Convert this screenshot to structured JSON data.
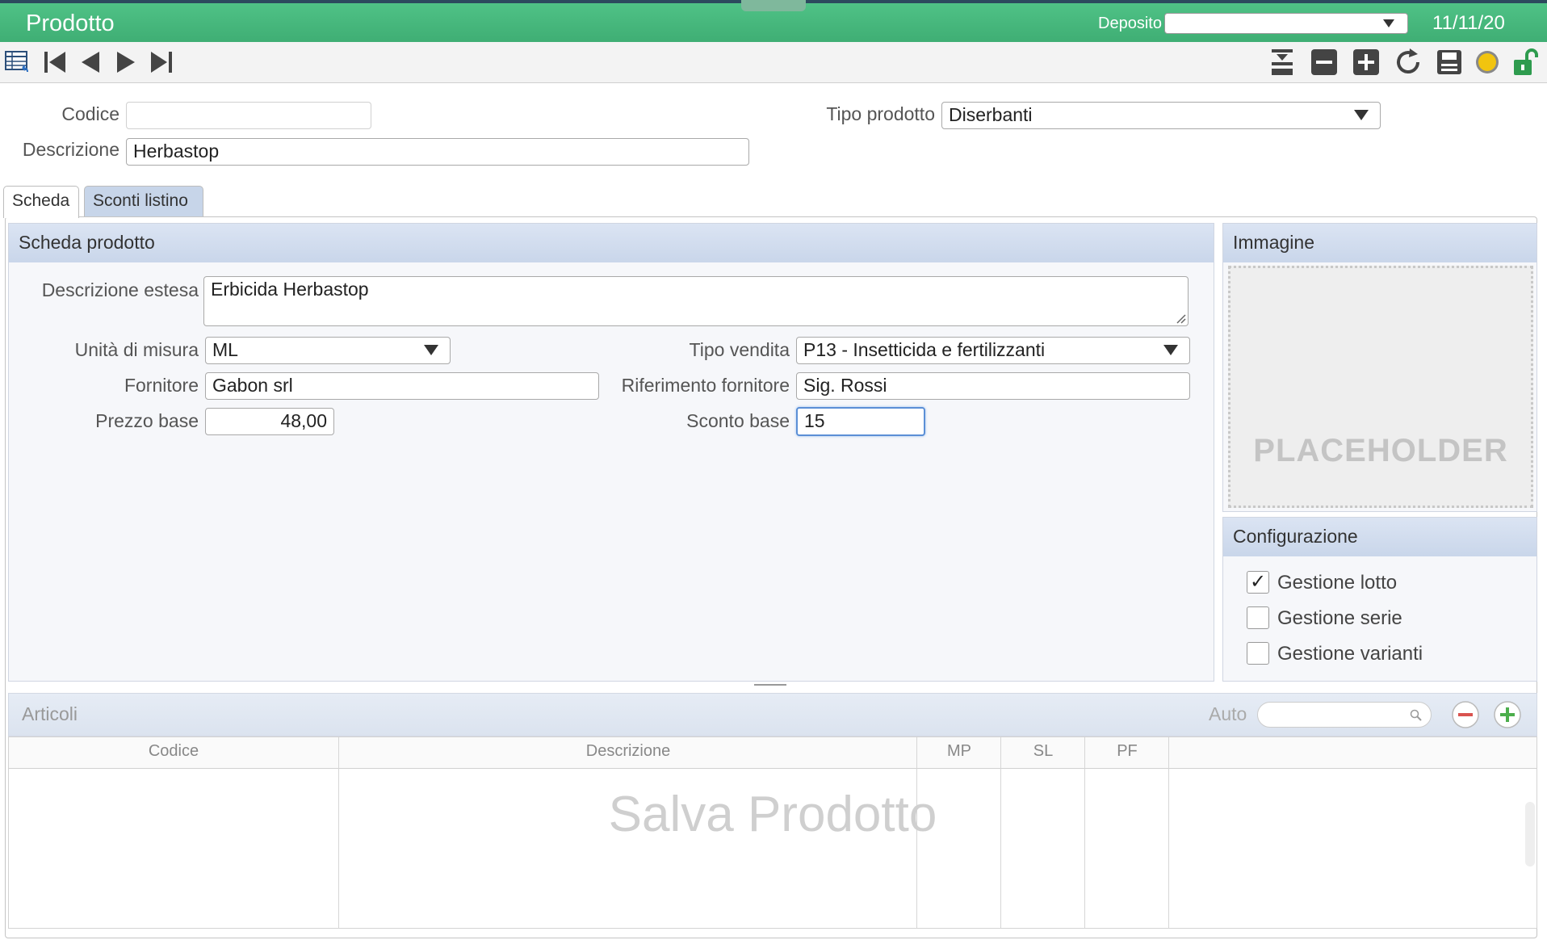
{
  "header": {
    "title": "Prodotto",
    "deposito_label": "Deposito",
    "deposito_value": "",
    "date": "11/11/20",
    "bg_color": "#45b57b"
  },
  "toolbar": {
    "left_icons": [
      "grid-list-icon",
      "first-record-icon",
      "previous-record-icon",
      "next-record-icon",
      "last-record-icon"
    ],
    "right_icons": [
      "import-icon",
      "delete-icon",
      "add-icon",
      "refresh-icon",
      "save-icon",
      "status-dot-icon",
      "lock-open-icon"
    ],
    "status_color": "#f1c40f",
    "lock_color": "#2e9b4e"
  },
  "form": {
    "codice_label": "Codice",
    "codice_value": "",
    "descrizione_label": "Descrizione",
    "descrizione_value": "Herbastop",
    "tipo_prodotto_label": "Tipo prodotto",
    "tipo_prodotto_value": "Diserbanti"
  },
  "tabs": [
    {
      "label": "Scheda",
      "active": true
    },
    {
      "label": "Sconti listino",
      "active": false
    }
  ],
  "scheda": {
    "title": "Scheda prodotto",
    "descrizione_estesa_label": "Descrizione estesa",
    "descrizione_estesa_value": "Erbicida Herbastop",
    "unita_label": "Unità di misura",
    "unita_value": "ML",
    "tipo_vendita_label": "Tipo vendita",
    "tipo_vendita_value": "P13 - Insetticida e fertilizzanti",
    "fornitore_label": "Fornitore",
    "fornitore_value": "Gabon srl",
    "rif_fornitore_label": "Riferimento fornitore",
    "rif_fornitore_value": "Sig. Rossi",
    "prezzo_label": "Prezzo base",
    "prezzo_value": "48,00",
    "sconto_label": "Sconto base",
    "sconto_value": "15"
  },
  "immagine": {
    "title": "Immagine",
    "placeholder": "PLACEHOLDER"
  },
  "configurazione": {
    "title": "Configurazione",
    "options": [
      {
        "label": "Gestione lotto",
        "checked": true
      },
      {
        "label": "Gestione serie",
        "checked": false
      },
      {
        "label": "Gestione varianti",
        "checked": false
      }
    ]
  },
  "articoli": {
    "title": "Articoli",
    "auto_label": "Auto",
    "search_value": "",
    "columns": [
      "Codice",
      "Descrizione",
      "MP",
      "SL",
      "PF"
    ],
    "empty_message": "Salva Prodotto"
  }
}
